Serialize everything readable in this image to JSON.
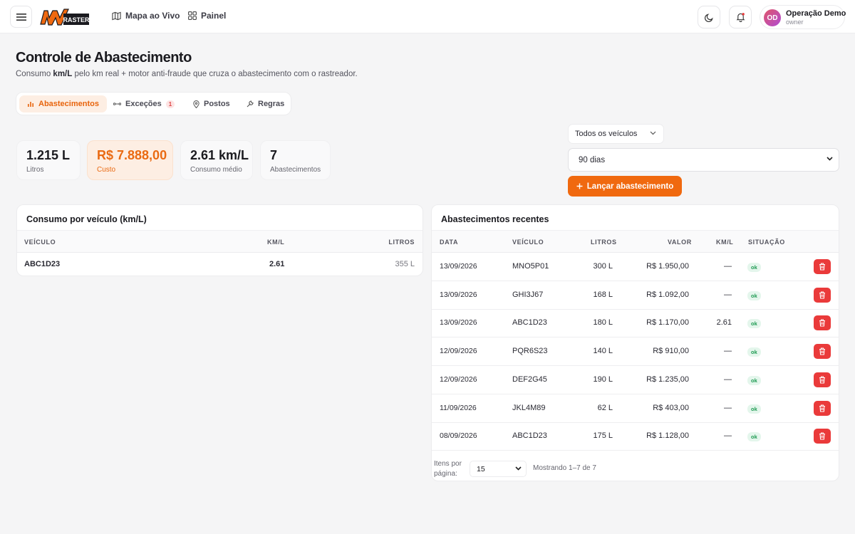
{
  "header": {
    "logo_text": "MV RASTER",
    "nav": [
      {
        "label": "Mapa ao Vivo",
        "icon": "map-icon"
      },
      {
        "label": "Painel",
        "icon": "grid-icon"
      }
    ],
    "user": {
      "initials": "OD",
      "name": "Operação Demo",
      "role": "owner"
    }
  },
  "page": {
    "title": "Controle de Abastecimento",
    "subtitle_pre": "Consumo ",
    "subtitle_bold": "km/L",
    "subtitle_post": " pelo km real + motor anti-fraude que cruza o abastecimento com o rastreador."
  },
  "tabs": [
    {
      "label": "Abastecimentos",
      "active": true
    },
    {
      "label": "Exceções",
      "badge": "1"
    },
    {
      "label": "Postos"
    },
    {
      "label": "Regras"
    }
  ],
  "stats": [
    {
      "value": "1.215 L",
      "label": "Litros"
    },
    {
      "value": "R$ 7.888,00",
      "label": "Custo"
    },
    {
      "value": "2.61 km/L",
      "label": "Consumo médio"
    },
    {
      "value": "7",
      "label": "Abastecimentos"
    }
  ],
  "filters": {
    "vehicle": "Todos os veículos",
    "period": "90 dias",
    "launch_button": "Lançar abastecimento"
  },
  "consumption_card": {
    "title": "Consumo por veículo (km/L)",
    "headers": [
      "VEÍCULO",
      "KM/L",
      "LITROS"
    ],
    "rows": [
      {
        "vehicle": "ABC1D23",
        "kml": "2.61",
        "liters": "355 L"
      }
    ]
  },
  "recent_card": {
    "title": "Abastecimentos recentes",
    "headers": [
      "DATA",
      "VEÍCULO",
      "LITROS",
      "VALOR",
      "KM/L",
      "SITUAÇÃO"
    ],
    "rows": [
      {
        "date": "13/09/2026",
        "vehicle": "MNO5P01",
        "liters": "300 L",
        "value": "R$ 1.950,00",
        "kml": "—",
        "status": "ok"
      },
      {
        "date": "13/09/2026",
        "vehicle": "GHI3J67",
        "liters": "168 L",
        "value": "R$ 1.092,00",
        "kml": "—",
        "status": "ok"
      },
      {
        "date": "13/09/2026",
        "vehicle": "ABC1D23",
        "liters": "180 L",
        "value": "R$ 1.170,00",
        "kml": "2.61",
        "status": "ok"
      },
      {
        "date": "12/09/2026",
        "vehicle": "PQR6S23",
        "liters": "140 L",
        "value": "R$ 910,00",
        "kml": "—",
        "status": "ok"
      },
      {
        "date": "12/09/2026",
        "vehicle": "DEF2G45",
        "liters": "190 L",
        "value": "R$ 1.235,00",
        "kml": "—",
        "status": "ok"
      },
      {
        "date": "11/09/2026",
        "vehicle": "JKL4M89",
        "liters": "62 L",
        "value": "R$ 403,00",
        "kml": "—",
        "status": "ok"
      },
      {
        "date": "08/09/2026",
        "vehicle": "ABC1D23",
        "liters": "175 L",
        "value": "R$ 1.128,00",
        "kml": "—",
        "status": "ok"
      }
    ],
    "pager": {
      "label": "Itens por página:",
      "size": "15",
      "info": "Mostrando 1–7 de 7"
    }
  },
  "colors": {
    "accent": "#f0690f",
    "danger": "#ea3a3a",
    "ok": "#1e9a52"
  }
}
